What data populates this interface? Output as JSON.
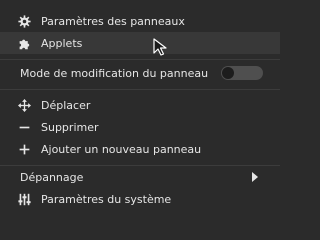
{
  "menu": {
    "panel_settings": {
      "label": "Paramètres des panneaux",
      "icon": "gear-icon"
    },
    "applets": {
      "label": "Applets",
      "icon": "puzzle-icon"
    },
    "edit_mode": {
      "label": "Mode de modification du panneau",
      "enabled": false
    },
    "move": {
      "label": "Déplacer",
      "icon": "move-arrows-icon"
    },
    "remove": {
      "label": "Supprimer",
      "icon": "minus-icon"
    },
    "add_panel": {
      "label": "Ajouter un nouveau panneau",
      "icon": "plus-icon"
    },
    "troubleshoot": {
      "label": "Dépannage",
      "icon": "chevron-right-icon"
    },
    "system_settings": {
      "label": "Paramètres du système",
      "icon": "sliders-icon"
    }
  },
  "colors": {
    "background": "#2b2b2b",
    "highlight": "#383838",
    "text": "#e6e6e6",
    "toggle_track": "#4f4f4f"
  }
}
